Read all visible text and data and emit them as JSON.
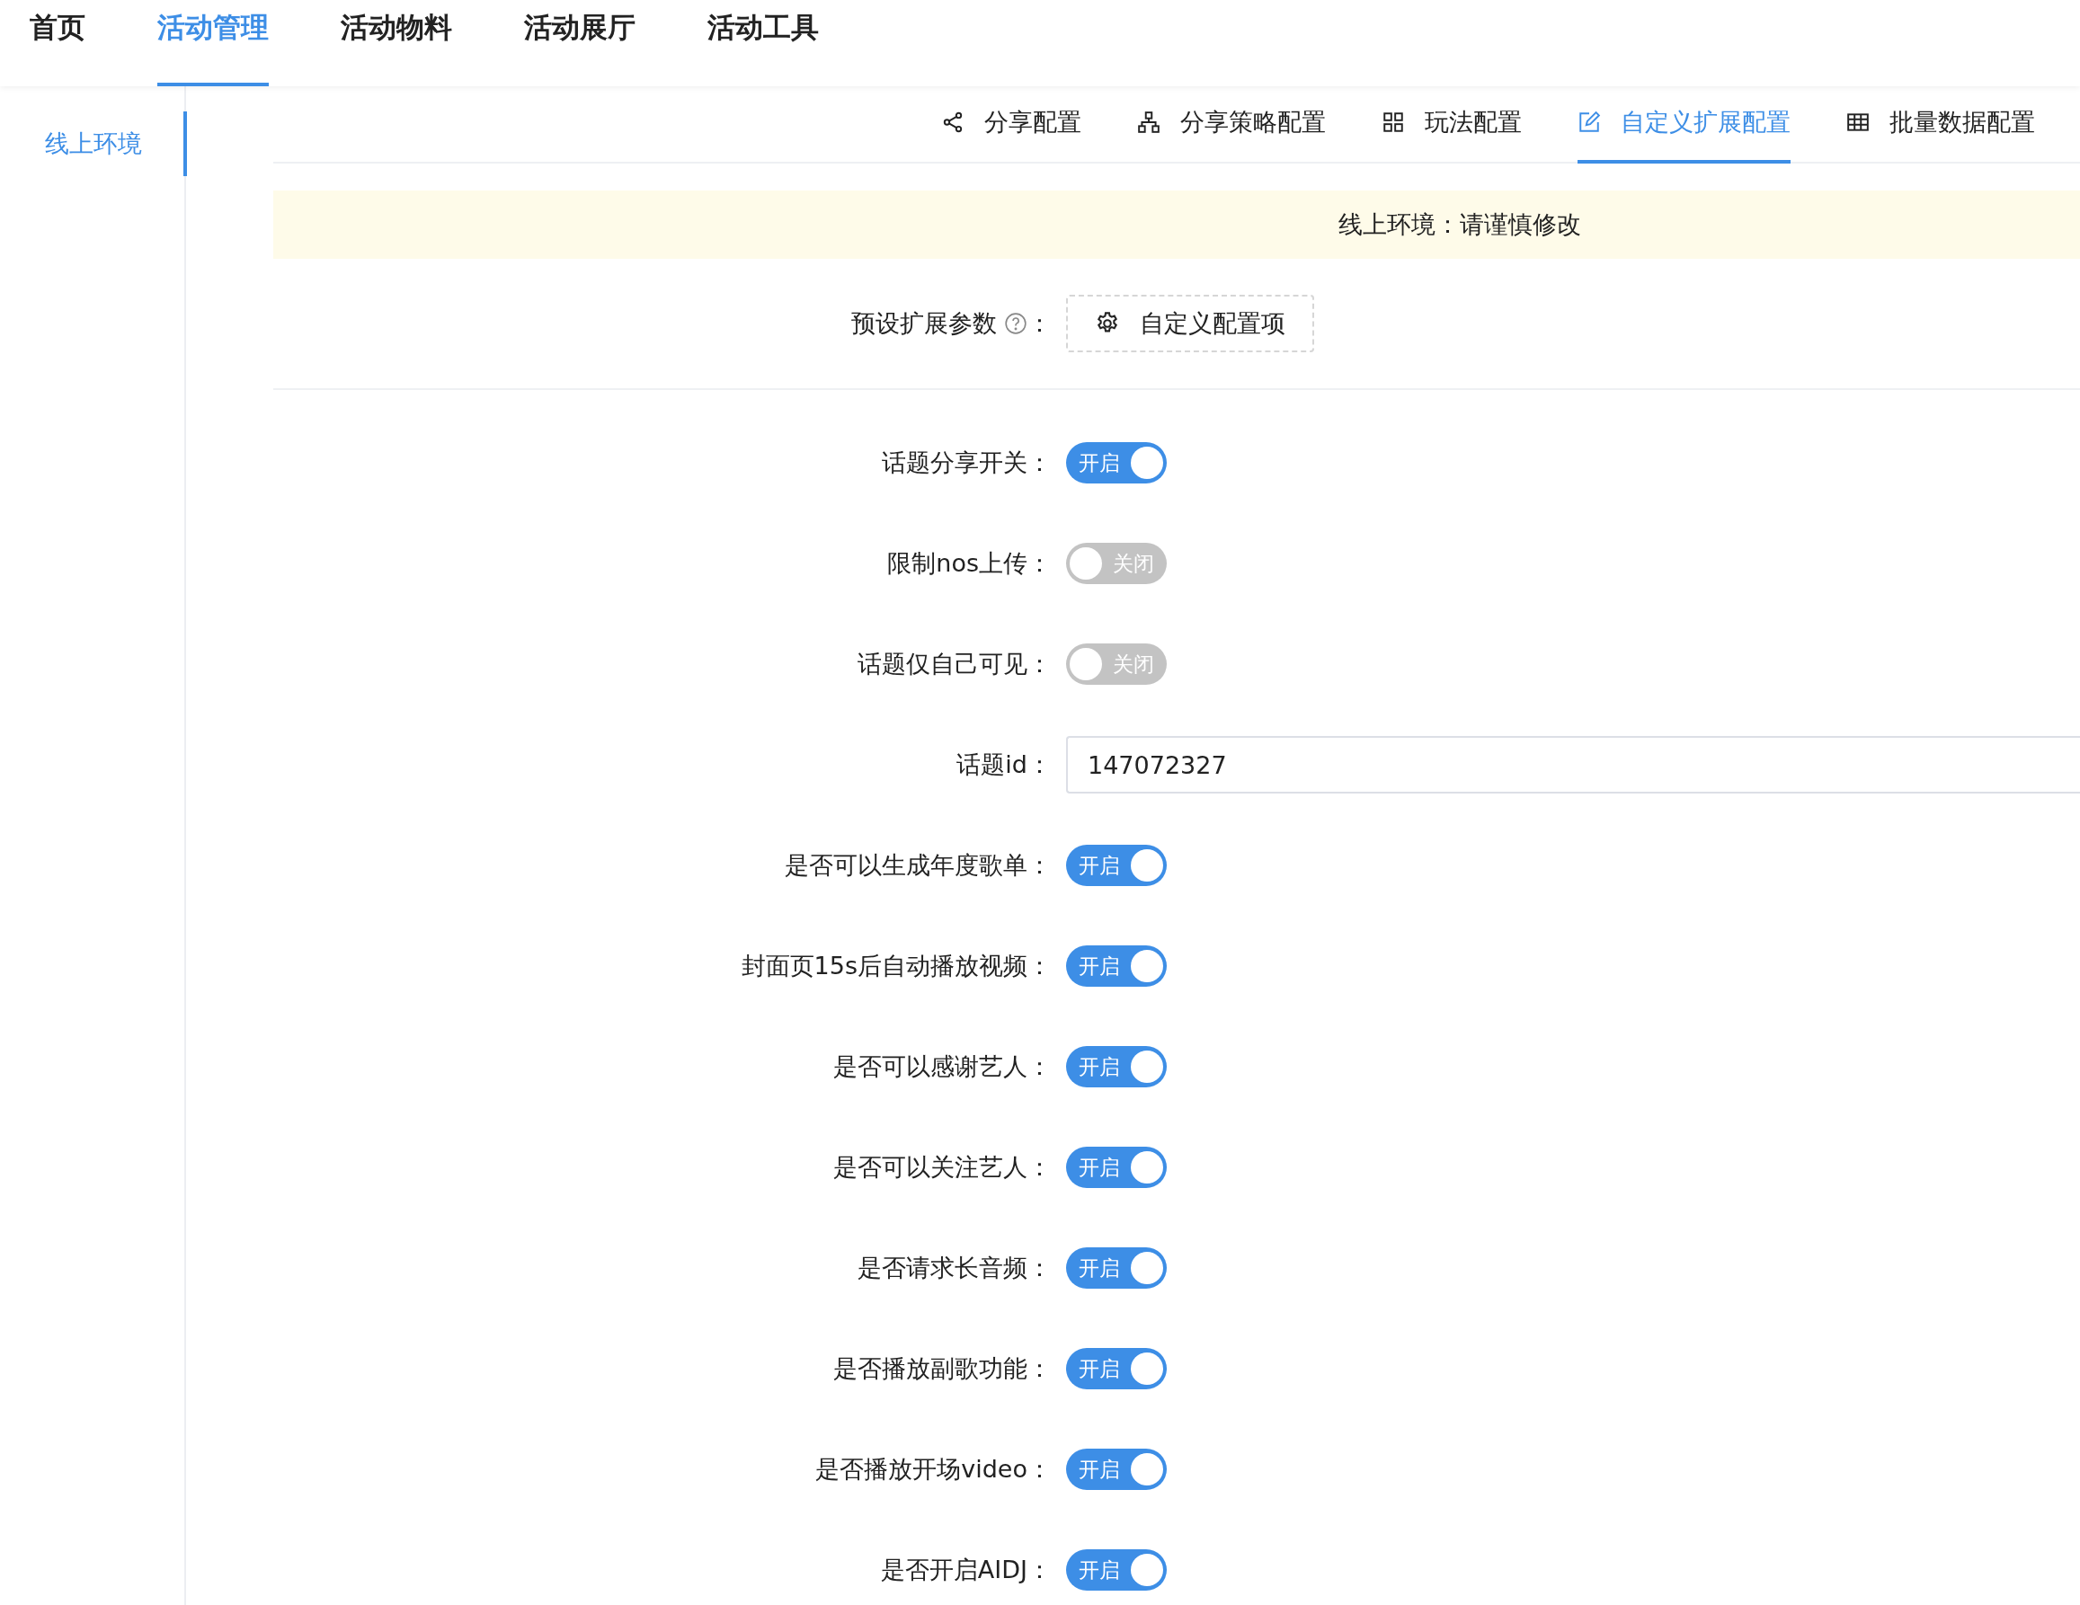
{
  "top_nav": [
    {
      "label": "首页",
      "selected": false
    },
    {
      "label": "活动管理",
      "selected": true
    },
    {
      "label": "活动物料",
      "selected": false
    },
    {
      "label": "活动展厅",
      "selected": false
    },
    {
      "label": "活动工具",
      "selected": false
    }
  ],
  "sidebar": {
    "items": [
      {
        "label": "线上环境",
        "selected": true
      }
    ]
  },
  "tabs": [
    {
      "label": "分享配置",
      "kind": "share",
      "selected": false
    },
    {
      "label": "分享策略配置",
      "kind": "tree",
      "selected": false
    },
    {
      "label": "玩法配置",
      "kind": "grid",
      "selected": false
    },
    {
      "label": "自定义扩展配置",
      "kind": "edit",
      "selected": true
    },
    {
      "label": "批量数据配置",
      "kind": "table",
      "selected": false
    }
  ],
  "notice": "线上环境：请谨慎修改",
  "preset": {
    "label": "预设扩展参数",
    "colon": "：",
    "button": "自定义配置项"
  },
  "fields": [
    {
      "kind": "switch",
      "label": "话题分享开关：",
      "on": true,
      "text": "开启"
    },
    {
      "kind": "switch",
      "label": "限制nos上传：",
      "on": false,
      "text": "关闭"
    },
    {
      "kind": "switch",
      "label": "话题仅自己可见：",
      "on": false,
      "text": "关闭"
    },
    {
      "kind": "input",
      "label": "话题id：",
      "value": "147072327"
    },
    {
      "kind": "switch",
      "label": "是否可以生成年度歌单：",
      "on": true,
      "text": "开启"
    },
    {
      "kind": "switch",
      "label": "封面页15s后自动播放视频：",
      "on": true,
      "text": "开启"
    },
    {
      "kind": "switch",
      "label": "是否可以感谢艺人：",
      "on": true,
      "text": "开启"
    },
    {
      "kind": "switch",
      "label": "是否可以关注艺人：",
      "on": true,
      "text": "开启"
    },
    {
      "kind": "switch",
      "label": "是否请求长音频：",
      "on": true,
      "text": "开启"
    },
    {
      "kind": "switch",
      "label": "是否播放副歌功能：",
      "on": true,
      "text": "开启"
    },
    {
      "kind": "switch",
      "label": "是否播放开场video：",
      "on": true,
      "text": "开启"
    },
    {
      "kind": "switch",
      "label": "是否开启AIDJ：",
      "on": true,
      "text": "开启"
    }
  ]
}
